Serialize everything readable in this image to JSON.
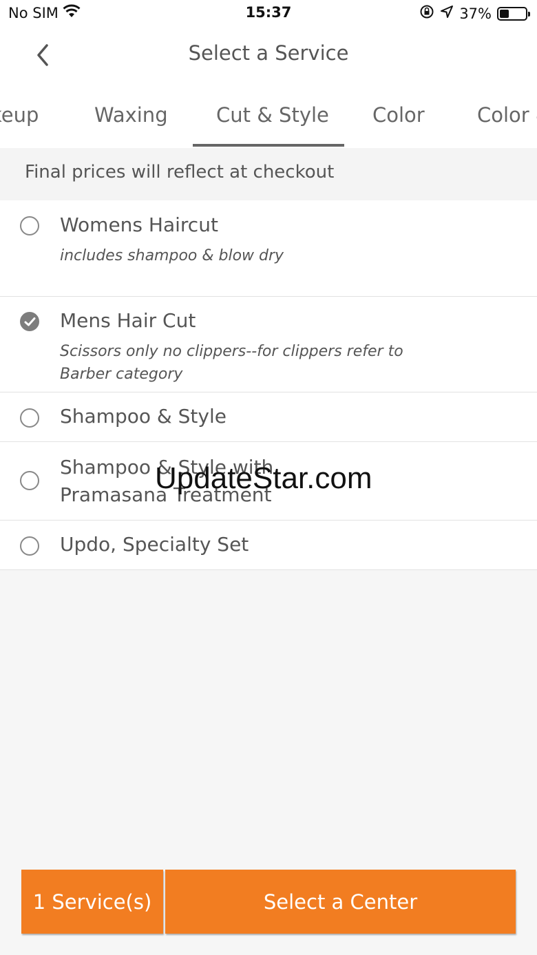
{
  "status_bar": {
    "carrier": "No SIM",
    "time": "15:37",
    "battery_percent": "37%",
    "battery_level": 0.37
  },
  "nav": {
    "title": "Select a Service"
  },
  "tabs": [
    {
      "label": "keup"
    },
    {
      "label": "Waxing"
    },
    {
      "label": "Cut & Style",
      "active": true
    },
    {
      "label": "Color"
    },
    {
      "label": "Color &"
    }
  ],
  "notice": "Final prices will reflect at checkout",
  "services": [
    {
      "title": "Womens Haircut",
      "subtitle": "includes shampoo & blow dry",
      "selected": false
    },
    {
      "title": "Mens Hair Cut",
      "subtitle": "Scissors only no clippers--for clippers refer to Barber category",
      "selected": true
    },
    {
      "title": "Shampoo & Style",
      "subtitle": "",
      "selected": false
    },
    {
      "title": "Shampoo & Style with Pramasana Treatment",
      "subtitle": "",
      "selected": false
    },
    {
      "title": "Updo, Specialty Set",
      "subtitle": "",
      "selected": false
    }
  ],
  "watermark": "UpdateStar.com",
  "footer": {
    "count_label": "1 Service(s)",
    "select_center_label": "Select a Center"
  },
  "colors": {
    "accent": "#f27d21",
    "checked_radio": "#7d7d7d"
  }
}
